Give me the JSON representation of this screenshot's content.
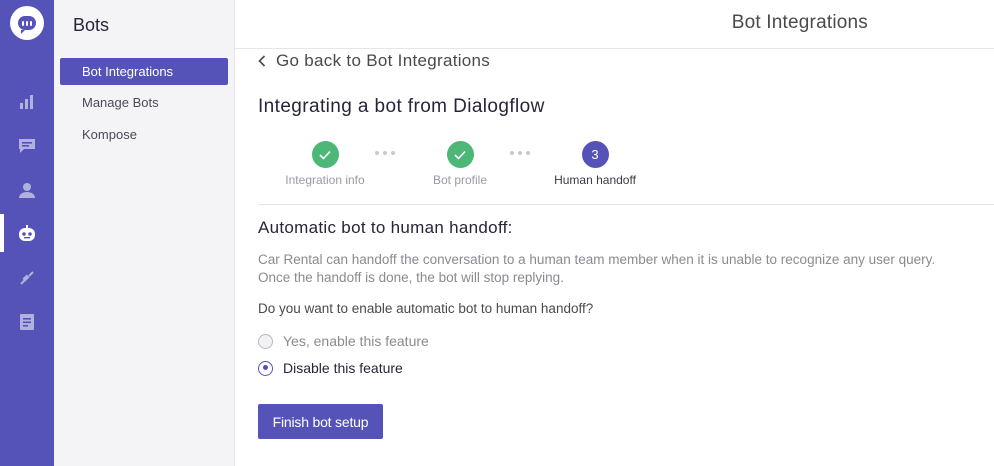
{
  "rail": {
    "icons": [
      "chat-logo-icon",
      "bar-chart-icon",
      "conversations-icon",
      "users-icon",
      "bot-icon",
      "integrations-icon",
      "document-icon"
    ],
    "accent": "#5553b7"
  },
  "sidebar": {
    "title": "Bots",
    "items": [
      {
        "label": "Bot Integrations",
        "active": true
      },
      {
        "label": "Manage Bots",
        "active": false
      },
      {
        "label": "Kompose",
        "active": false
      }
    ]
  },
  "header": {
    "title": "Bot Integrations"
  },
  "main": {
    "back_label": "Go back to Bot Integrations",
    "page_title": "Integrating a bot from Dialogflow",
    "steps": [
      {
        "label": "Integration info",
        "state": "done"
      },
      {
        "label": "Bot profile",
        "state": "done"
      },
      {
        "label": "Human handoff",
        "state": "current",
        "number": "3"
      }
    ],
    "section_title": "Automatic bot to human handoff:",
    "description_line1": "Car Rental can handoff the conversation to a human team member when it is unable to recognize any user query.",
    "description_line2": "Once the handoff is done, the bot will stop replying.",
    "question": "Do you want to enable automatic bot to human handoff?",
    "options": [
      {
        "label": "Yes, enable this feature",
        "selected": false
      },
      {
        "label": "Disable this feature",
        "selected": true
      }
    ],
    "finish_label": "Finish bot setup"
  },
  "colors": {
    "accent": "#5553b7",
    "success": "#4cb777"
  }
}
